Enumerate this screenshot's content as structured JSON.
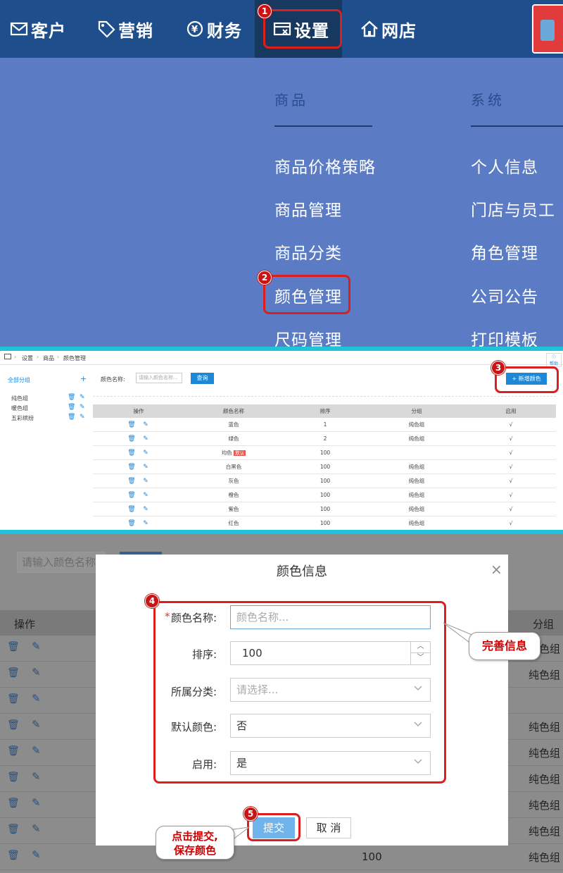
{
  "topnav": {
    "items": [
      "客户",
      "营销",
      "财务",
      "设置",
      "网店"
    ]
  },
  "dropdown": {
    "columns": [
      {
        "header": "商品",
        "items": [
          "商品价格策略",
          "商品管理",
          "商品分类",
          "颜色管理",
          "尺码管理"
        ]
      },
      {
        "header": "系统",
        "items": [
          "个人信息",
          "门店与员工",
          "角色管理",
          "公司公告",
          "打印模板"
        ]
      }
    ]
  },
  "steps": [
    "1",
    "2",
    "3",
    "4",
    "5"
  ],
  "breadcrumb": [
    "设置",
    "商品",
    "颜色管理"
  ],
  "help_label": "帮助",
  "sidebar": {
    "title": "全部分组",
    "add": "+",
    "groups": [
      "纯色组",
      "暖色组",
      "五彩缤纷"
    ]
  },
  "search": {
    "label": "颜色名称:",
    "placeholder": "请输入颜色名称...",
    "query_button": "查询"
  },
  "add_button": "+ 新增颜色",
  "table": {
    "headers": [
      "操作",
      "颜色名称",
      "排序",
      "分组",
      "启用"
    ],
    "rows": [
      {
        "name": "蓝色",
        "tag": "",
        "order": "1",
        "group": "纯色组",
        "enabled": "√"
      },
      {
        "name": "绿色",
        "tag": "",
        "order": "2",
        "group": "纯色组",
        "enabled": "√"
      },
      {
        "name": "均色",
        "tag": "默认",
        "order": "100",
        "group": "",
        "enabled": "√"
      },
      {
        "name": "白黑色",
        "tag": "",
        "order": "100",
        "group": "纯色组",
        "enabled": "√"
      },
      {
        "name": "灰色",
        "tag": "",
        "order": "100",
        "group": "纯色组",
        "enabled": "√"
      },
      {
        "name": "橙色",
        "tag": "",
        "order": "100",
        "group": "纯色组",
        "enabled": "√"
      },
      {
        "name": "紫色",
        "tag": "",
        "order": "100",
        "group": "纯色组",
        "enabled": "√"
      },
      {
        "name": "红色",
        "tag": "",
        "order": "100",
        "group": "纯色组",
        "enabled": "√"
      }
    ]
  },
  "background": {
    "search_placeholder": "请输入颜色名称...",
    "header_op": "操作",
    "header_group": "分组",
    "group_cells": [
      "色组",
      "纯色组",
      "纯色组",
      "纯色组",
      "纯色组",
      "纯色组",
      "纯色组",
      "纯色组"
    ],
    "last_order": "100"
  },
  "modal": {
    "title": "颜色信息",
    "close": "×",
    "fields": {
      "name_label": "颜色名称:",
      "name_required": "*",
      "name_placeholder": "颜色名称...",
      "order_label": "排序:",
      "order_value": "100",
      "category_label": "所属分类:",
      "category_placeholder": "请选择...",
      "default_label": "默认颜色:",
      "default_value": "否",
      "enabled_label": "启用:",
      "enabled_value": "是"
    },
    "submit": "提交",
    "cancel": "取 消"
  },
  "callouts": {
    "info": "完善信息",
    "submit_line1": "点击提交,",
    "submit_line2": "保存颜色"
  },
  "colors": {
    "nav_bg": "#1e4f8c",
    "dropdown_bg": "#5b7cc4",
    "highlight": "#d9201f",
    "primary": "#1d87d8",
    "separator": "#1fc4d9"
  }
}
